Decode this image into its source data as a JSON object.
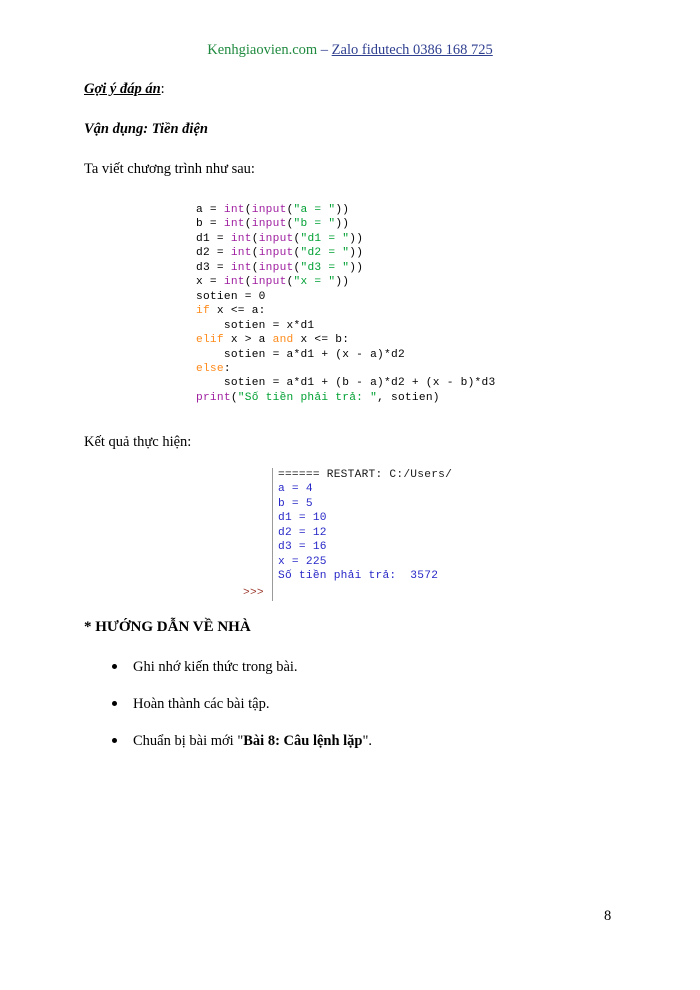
{
  "header": {
    "site": "Kenhgiaovien.com",
    "separator": " – ",
    "contact": "Zalo fidutech 0386 168 725",
    "site_color": "#1f8a3f",
    "contact_color": "#2f3f8f"
  },
  "body": {
    "answer_label": "Gợi ý đáp án",
    "answer_label_colon": ":",
    "application_heading": "Vận dụng: Tiền điện",
    "intro": "Ta viết chương trình như sau:",
    "result_label": "Kết quả thực hiện:"
  },
  "code": {
    "language": "python",
    "colors": {
      "builtin": "#9f1fa0",
      "string": "#00a033",
      "keyword": "#ff8a1a",
      "plain": "#000000"
    },
    "lines": [
      "a = int(input(\"a = \"))",
      "b = int(input(\"b = \"))",
      "d1 = int(input(\"d1 = \"))",
      "d2 = int(input(\"d2 = \"))",
      "d3 = int(input(\"d3 = \"))",
      "x = int(input(\"x = \"))",
      "sotien = 0",
      "if x <= a:",
      "    sotien = x*d1",
      "elif x > a and x <= b:",
      "    sotien = a*d1 + (x - a)*d2",
      "else:",
      "    sotien = a*d1 + (b - a)*d2 + (x - b)*d3",
      "print(\"Số tiền phải trả: \", sotien)"
    ]
  },
  "console": {
    "prompt": ">>>",
    "prompt_color": "#9c3b30",
    "output_color": "#2727c8",
    "restart_line": "====== RESTART: C:/Users/",
    "lines": [
      "a = 4",
      "b = 5",
      "d1 = 10",
      "d2 = 12",
      "d3 = 16",
      "x = 225",
      "Số tiền phải trả:  3572"
    ]
  },
  "homework": {
    "heading": "* HƯỚNG DẪN VỀ NHÀ",
    "items": [
      {
        "text": "Ghi nhớ kiến thức trong bài.",
        "bold_part": "",
        "tail": ""
      },
      {
        "text": "Hoàn thành các bài tập.",
        "bold_part": "",
        "tail": ""
      },
      {
        "text": "Chuẩn bị bài mới \"",
        "bold_part": "Bài 8: Câu lệnh lặp",
        "tail": "\"."
      }
    ]
  },
  "footer": {
    "page_number": "8"
  }
}
